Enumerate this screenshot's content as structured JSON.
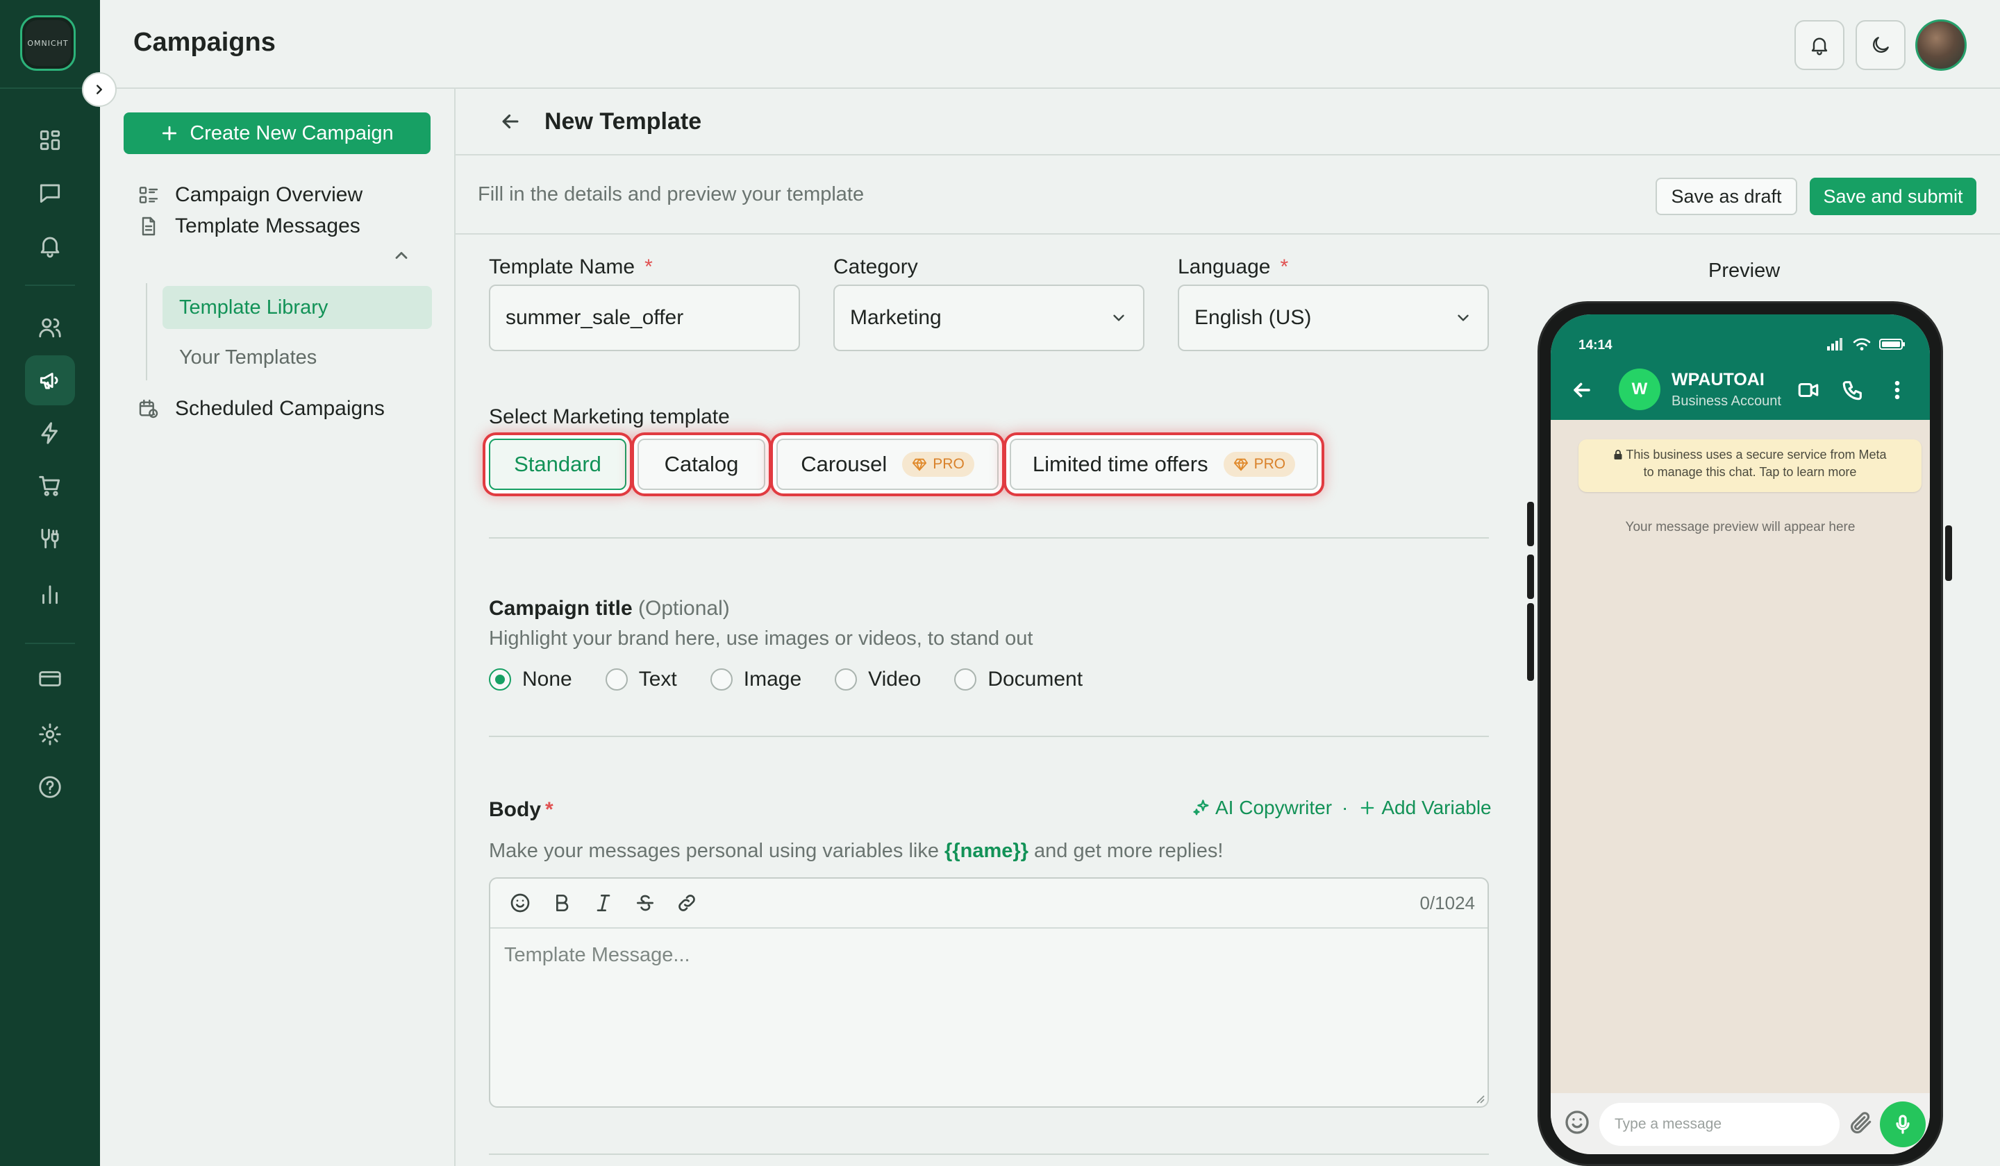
{
  "app": {
    "logo_text": "OMNICHT",
    "page_title": "Campaigns"
  },
  "rail": {
    "icons": [
      "dashboard-icon",
      "chat-icon",
      "bell-icon",
      "users-icon",
      "megaphone-icon",
      "bolt-icon",
      "cart-icon",
      "integration-icon",
      "analytics-icon",
      "card-icon",
      "gear-icon",
      "help-icon"
    ],
    "active": "megaphone-icon"
  },
  "sidebar": {
    "create_label": "Create New Campaign",
    "overview_label": "Campaign Overview",
    "template_messages_label": "Template Messages",
    "template_library_label": "Template Library",
    "your_templates_label": "Your Templates",
    "scheduled_label": "Scheduled Campaigns"
  },
  "editor_header": {
    "title": "New Template",
    "subtitle": "Fill in the details and preview your template",
    "save_draft": "Save as draft",
    "save_submit": "Save and submit"
  },
  "form": {
    "template_name": {
      "label": "Template Name",
      "required": "*",
      "value": "summer_sale_offer"
    },
    "category": {
      "label": "Category",
      "value": "Marketing"
    },
    "language": {
      "label": "Language",
      "required": "*",
      "value": "English (US)"
    },
    "select_template_label": "Select Marketing template",
    "template_types": [
      {
        "label": "Standard",
        "selected": true
      },
      {
        "label": "Catalog"
      },
      {
        "label": "Carousel",
        "badge": "PRO"
      },
      {
        "label": "Limited time offers",
        "badge": "PRO"
      }
    ],
    "campaign_title": {
      "label": "Campaign title",
      "optional": "(Optional)",
      "hint": "Highlight your brand here, use images or videos, to stand out",
      "options": [
        "None",
        "Text",
        "Image",
        "Video",
        "Document"
      ],
      "selected": "None"
    },
    "body": {
      "label": "Body",
      "required": "*",
      "ai_copywriter": "AI Copywriter",
      "separator": "·",
      "add_variable": "Add Variable",
      "hint_before": "Make your messages personal using variables like",
      "hint_var": "{{name}}",
      "hint_after": "and get more replies!",
      "counter": "0/1024",
      "placeholder": "Template Message..."
    }
  },
  "preview": {
    "label": "Preview",
    "status_time": "14:14",
    "contact_initial": "W",
    "contact_name": "WPAUTOAI",
    "contact_sub": "Business Account",
    "notice_line1": "This business uses a secure service from Meta",
    "notice_line2": "to manage this chat. Tap to learn more",
    "empty_text": "Your message preview will appear here",
    "input_placeholder": "Type a message"
  },
  "colors": {
    "rail_bg": "#123f2e",
    "brand_green": "#17a064",
    "highlight_red": "#e13b41",
    "pro_orange": "#d9822b",
    "wa_header": "#0c7a60"
  }
}
